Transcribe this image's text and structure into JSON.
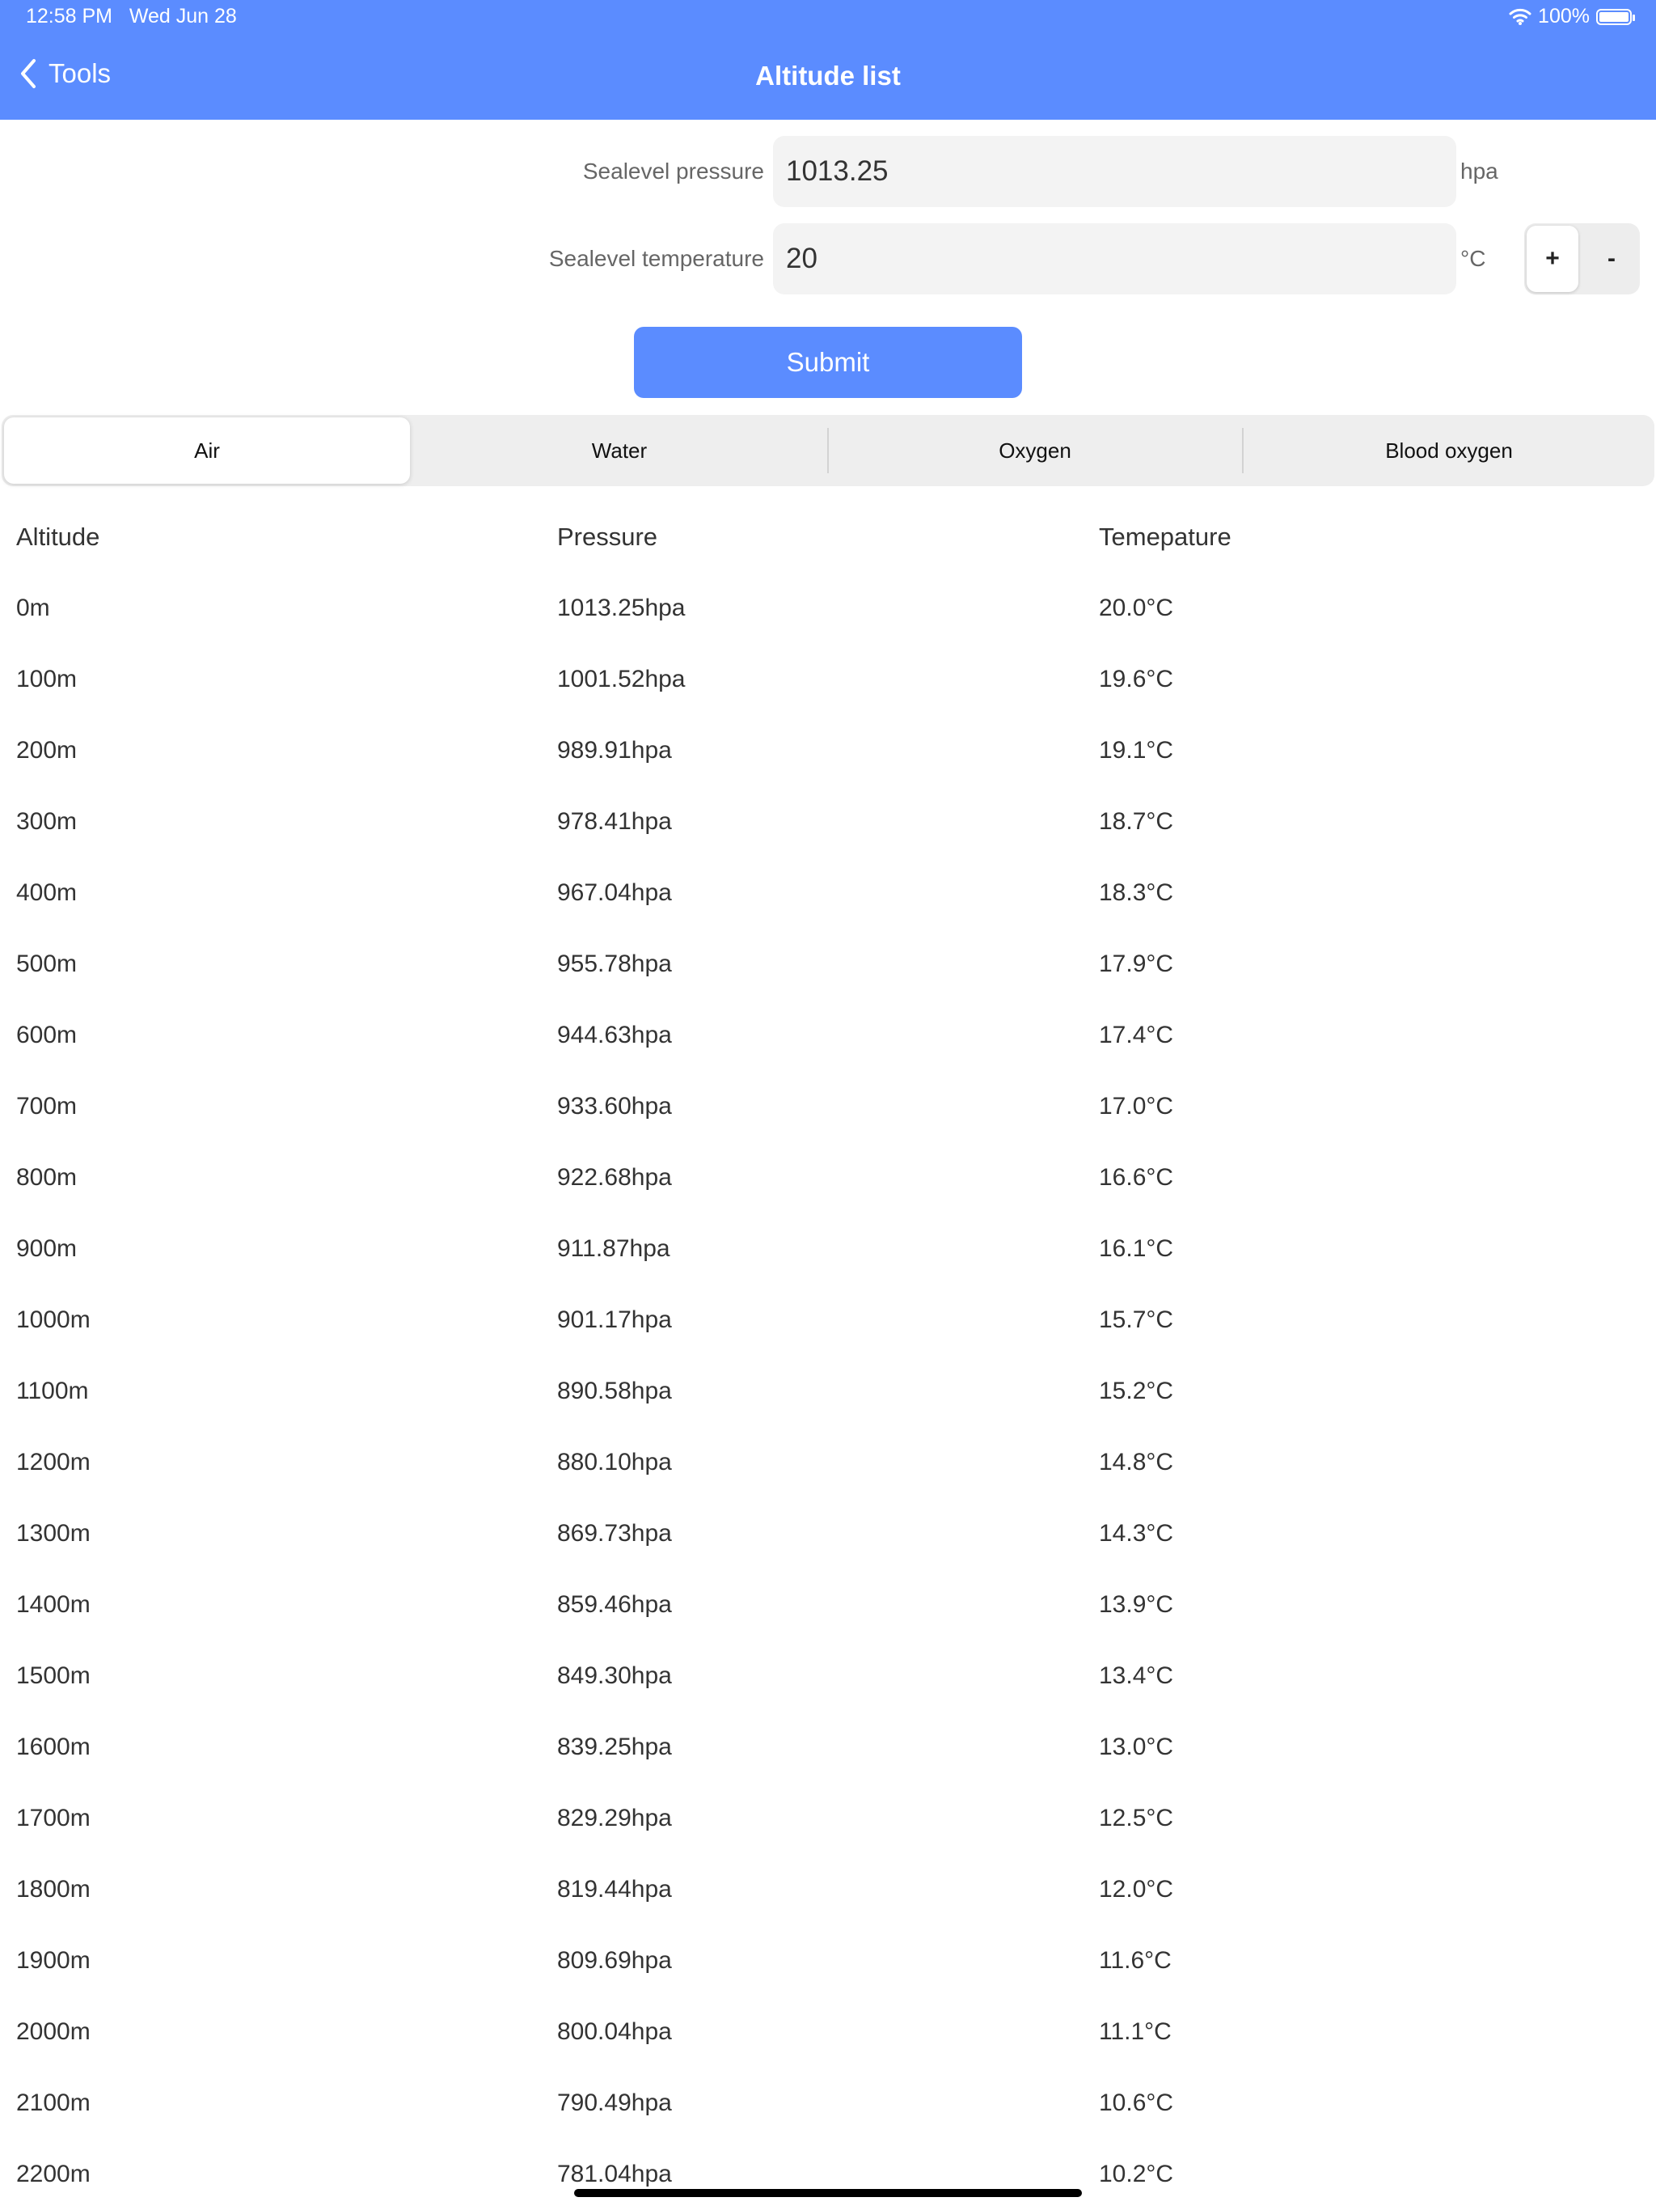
{
  "status_bar": {
    "time": "12:58 PM",
    "date": "Wed Jun 28",
    "battery": "100%"
  },
  "nav": {
    "back_label": "Tools",
    "title": "Altitude list"
  },
  "form": {
    "pressure": {
      "label": "Sealevel pressure",
      "value": "1013.25",
      "unit": "hpa"
    },
    "temperature": {
      "label": "Sealevel temperature",
      "value": "20",
      "unit": "°C",
      "plus": "+",
      "minus": "-"
    },
    "submit_label": "Submit"
  },
  "tabs": [
    {
      "label": "Air",
      "active": true
    },
    {
      "label": "Water"
    },
    {
      "label": "Oxygen"
    },
    {
      "label": "Blood oxygen"
    }
  ],
  "table": {
    "headers": [
      "Altitude",
      "Pressure",
      "Temepature"
    ],
    "rows": [
      [
        "0m",
        "1013.25hpa",
        "20.0°C"
      ],
      [
        "100m",
        "1001.52hpa",
        "19.6°C"
      ],
      [
        "200m",
        "989.91hpa",
        "19.1°C"
      ],
      [
        "300m",
        "978.41hpa",
        "18.7°C"
      ],
      [
        "400m",
        "967.04hpa",
        "18.3°C"
      ],
      [
        "500m",
        "955.78hpa",
        "17.9°C"
      ],
      [
        "600m",
        "944.63hpa",
        "17.4°C"
      ],
      [
        "700m",
        "933.60hpa",
        "17.0°C"
      ],
      [
        "800m",
        "922.68hpa",
        "16.6°C"
      ],
      [
        "900m",
        "911.87hpa",
        "16.1°C"
      ],
      [
        "1000m",
        "901.17hpa",
        "15.7°C"
      ],
      [
        "1100m",
        "890.58hpa",
        "15.2°C"
      ],
      [
        "1200m",
        "880.10hpa",
        "14.8°C"
      ],
      [
        "1300m",
        "869.73hpa",
        "14.3°C"
      ],
      [
        "1400m",
        "859.46hpa",
        "13.9°C"
      ],
      [
        "1500m",
        "849.30hpa",
        "13.4°C"
      ],
      [
        "1600m",
        "839.25hpa",
        "13.0°C"
      ],
      [
        "1700m",
        "829.29hpa",
        "12.5°C"
      ],
      [
        "1800m",
        "819.44hpa",
        "12.0°C"
      ],
      [
        "1900m",
        "809.69hpa",
        "11.6°C"
      ],
      [
        "2000m",
        "800.04hpa",
        "11.1°C"
      ],
      [
        "2100m",
        "790.49hpa",
        "10.6°C"
      ],
      [
        "2200m",
        "781.04hpa",
        "10.2°C"
      ]
    ]
  },
  "colors": {
    "accent": "#5b8cff",
    "input_bg": "#f3f3f3",
    "segment_bg": "#eeeeee"
  }
}
